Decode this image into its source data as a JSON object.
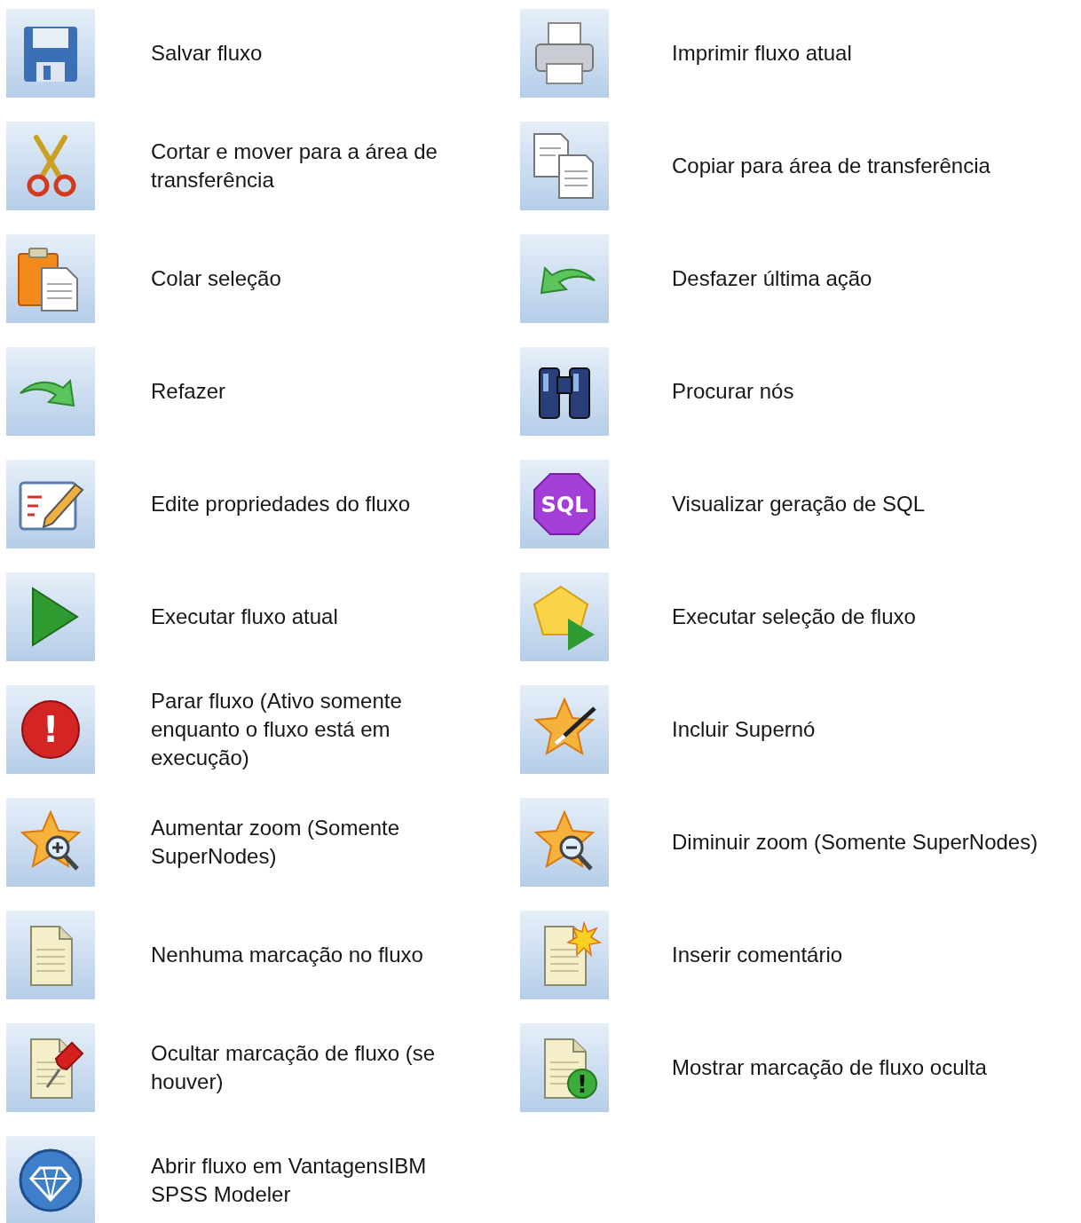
{
  "items": [
    {
      "label": "Salvar fluxo"
    },
    {
      "label": "Imprimir fluxo atual"
    },
    {
      "label": "Cortar e mover para a área de transferência"
    },
    {
      "label": "Copiar para área de transferência"
    },
    {
      "label": "Colar seleção"
    },
    {
      "label": "Desfazer última ação"
    },
    {
      "label": "Refazer"
    },
    {
      "label": "Procurar nós"
    },
    {
      "label": "Edite propriedades do fluxo"
    },
    {
      "label": "Visualizar geração de SQL",
      "icon_text": "SQL"
    },
    {
      "label": "Executar fluxo atual"
    },
    {
      "label": "Executar seleção de fluxo"
    },
    {
      "label": "Parar fluxo (Ativo somente enquanto o fluxo está em execução)",
      "icon_text": "!"
    },
    {
      "label": "Incluir Supernó"
    },
    {
      "label": "Aumentar zoom (Somente SuperNodes)"
    },
    {
      "label": "Diminuir zoom (Somente SuperNodes)"
    },
    {
      "label": "Nenhuma marcação no fluxo"
    },
    {
      "label": "Inserir comentário"
    },
    {
      "label": "Ocultar marcação de fluxo (se houver)"
    },
    {
      "label": "Mostrar marcação de fluxo oculta",
      "icon_text": "!"
    },
    {
      "label": "Abrir fluxo em VantagensIBM SPSS Modeler"
    }
  ]
}
